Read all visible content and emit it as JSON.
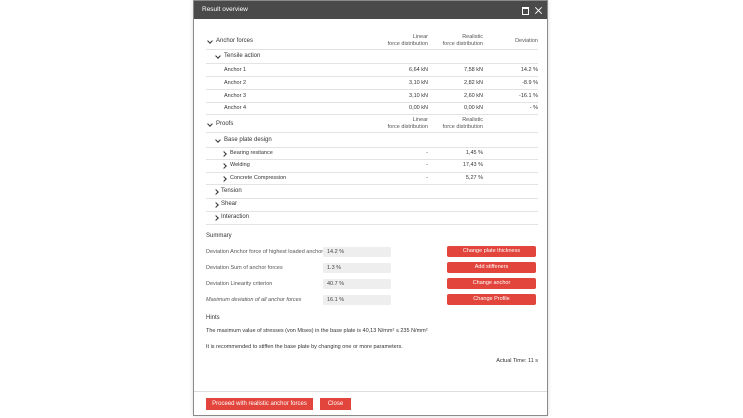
{
  "dialog": {
    "title": "Result overview"
  },
  "anchor_forces": {
    "label": "Anchor forces",
    "col_linear_1": "Linear",
    "col_linear_2": "force distribution",
    "col_realistic_1": "Realistic",
    "col_realistic_2": "force distribution",
    "col_deviation": "Deviation",
    "tensile_action": "Tensile action",
    "rows": [
      {
        "name": "Anchor 1",
        "linear": "6,64 kN",
        "realistic": "7,58 kN",
        "deviation": "14.2 %"
      },
      {
        "name": "Anchor 2",
        "linear": "3,10 kN",
        "realistic": "2,82 kN",
        "deviation": "-8.9 %"
      },
      {
        "name": "Anchor 3",
        "linear": "3,10 kN",
        "realistic": "2,60 kN",
        "deviation": "-16.1 %"
      },
      {
        "name": "Anchor 4",
        "linear": "0,00 kN",
        "realistic": "0,00 kN",
        "deviation": "- %"
      }
    ]
  },
  "proofs": {
    "label": "Proofs",
    "col_linear_1": "Linear",
    "col_linear_2": "force distribution",
    "col_realistic_1": "Realistic",
    "col_realistic_2": "force distribution",
    "base_plate_design": "Base plate design",
    "rows": [
      {
        "name": "Bearing resitance",
        "linear": "-",
        "realistic": "1,45 %"
      },
      {
        "name": "Welding",
        "linear": "-",
        "realistic": "17,43 %"
      },
      {
        "name": "Concrete Compression",
        "linear": "-",
        "realistic": "5,27 %"
      }
    ],
    "groups": [
      "Tension",
      "Shear",
      "Interaction"
    ]
  },
  "summary": {
    "label": "Summary",
    "rows": [
      {
        "label": "Deviation Anchor force of highest loaded anchor",
        "value": "14.2 %"
      },
      {
        "label": "Deviation Sum of anchor forces",
        "value": "1.3 %"
      },
      {
        "label": "Deviation Linearity criterion",
        "value": "40.7 %"
      },
      {
        "label": "Maximum deviation of all anchor forces",
        "value": "16.1 %"
      }
    ],
    "buttons": [
      "Change plate thickness",
      "Add stiffeners",
      "Change anchor",
      "Change Profile"
    ]
  },
  "hints": {
    "label": "Hints",
    "line1": "The maximum value of stresses (von Mises) in the base plate is 40,13 N/mm² ≤ 235 N/mm²",
    "line2": "It is recommended to stiffen the base plate by changing one or more parameters.",
    "actual_time": "Actual Time: 11 s"
  },
  "footer": {
    "proceed_label": "Proceed with realistic anchor forces",
    "close_label": "Close"
  },
  "colors": {
    "accent": "#e2453c",
    "titlebar": "#4a4a4a",
    "field": "#eeeeee"
  }
}
